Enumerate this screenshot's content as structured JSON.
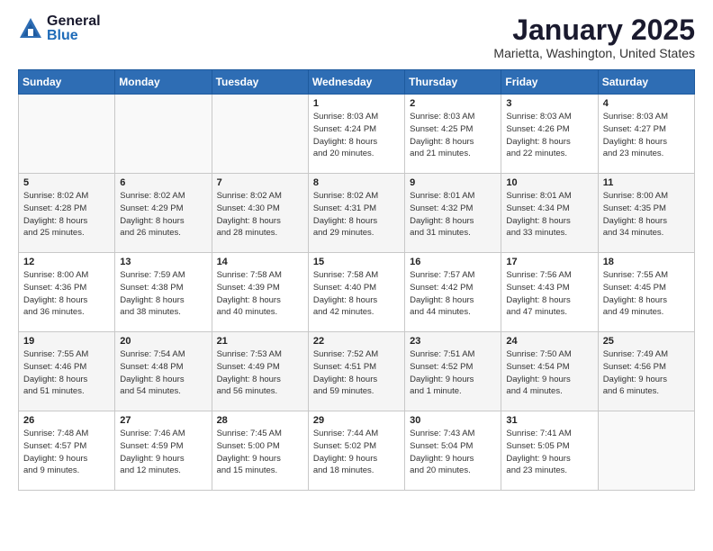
{
  "logo": {
    "general": "General",
    "blue": "Blue"
  },
  "header": {
    "month": "January 2025",
    "location": "Marietta, Washington, United States"
  },
  "weekdays": [
    "Sunday",
    "Monday",
    "Tuesday",
    "Wednesday",
    "Thursday",
    "Friday",
    "Saturday"
  ],
  "weeks": [
    [
      {
        "day": "",
        "info": ""
      },
      {
        "day": "",
        "info": ""
      },
      {
        "day": "",
        "info": ""
      },
      {
        "day": "1",
        "info": "Sunrise: 8:03 AM\nSunset: 4:24 PM\nDaylight: 8 hours\nand 20 minutes."
      },
      {
        "day": "2",
        "info": "Sunrise: 8:03 AM\nSunset: 4:25 PM\nDaylight: 8 hours\nand 21 minutes."
      },
      {
        "day": "3",
        "info": "Sunrise: 8:03 AM\nSunset: 4:26 PM\nDaylight: 8 hours\nand 22 minutes."
      },
      {
        "day": "4",
        "info": "Sunrise: 8:03 AM\nSunset: 4:27 PM\nDaylight: 8 hours\nand 23 minutes."
      }
    ],
    [
      {
        "day": "5",
        "info": "Sunrise: 8:02 AM\nSunset: 4:28 PM\nDaylight: 8 hours\nand 25 minutes."
      },
      {
        "day": "6",
        "info": "Sunrise: 8:02 AM\nSunset: 4:29 PM\nDaylight: 8 hours\nand 26 minutes."
      },
      {
        "day": "7",
        "info": "Sunrise: 8:02 AM\nSunset: 4:30 PM\nDaylight: 8 hours\nand 28 minutes."
      },
      {
        "day": "8",
        "info": "Sunrise: 8:02 AM\nSunset: 4:31 PM\nDaylight: 8 hours\nand 29 minutes."
      },
      {
        "day": "9",
        "info": "Sunrise: 8:01 AM\nSunset: 4:32 PM\nDaylight: 8 hours\nand 31 minutes."
      },
      {
        "day": "10",
        "info": "Sunrise: 8:01 AM\nSunset: 4:34 PM\nDaylight: 8 hours\nand 33 minutes."
      },
      {
        "day": "11",
        "info": "Sunrise: 8:00 AM\nSunset: 4:35 PM\nDaylight: 8 hours\nand 34 minutes."
      }
    ],
    [
      {
        "day": "12",
        "info": "Sunrise: 8:00 AM\nSunset: 4:36 PM\nDaylight: 8 hours\nand 36 minutes."
      },
      {
        "day": "13",
        "info": "Sunrise: 7:59 AM\nSunset: 4:38 PM\nDaylight: 8 hours\nand 38 minutes."
      },
      {
        "day": "14",
        "info": "Sunrise: 7:58 AM\nSunset: 4:39 PM\nDaylight: 8 hours\nand 40 minutes."
      },
      {
        "day": "15",
        "info": "Sunrise: 7:58 AM\nSunset: 4:40 PM\nDaylight: 8 hours\nand 42 minutes."
      },
      {
        "day": "16",
        "info": "Sunrise: 7:57 AM\nSunset: 4:42 PM\nDaylight: 8 hours\nand 44 minutes."
      },
      {
        "day": "17",
        "info": "Sunrise: 7:56 AM\nSunset: 4:43 PM\nDaylight: 8 hours\nand 47 minutes."
      },
      {
        "day": "18",
        "info": "Sunrise: 7:55 AM\nSunset: 4:45 PM\nDaylight: 8 hours\nand 49 minutes."
      }
    ],
    [
      {
        "day": "19",
        "info": "Sunrise: 7:55 AM\nSunset: 4:46 PM\nDaylight: 8 hours\nand 51 minutes."
      },
      {
        "day": "20",
        "info": "Sunrise: 7:54 AM\nSunset: 4:48 PM\nDaylight: 8 hours\nand 54 minutes."
      },
      {
        "day": "21",
        "info": "Sunrise: 7:53 AM\nSunset: 4:49 PM\nDaylight: 8 hours\nand 56 minutes."
      },
      {
        "day": "22",
        "info": "Sunrise: 7:52 AM\nSunset: 4:51 PM\nDaylight: 8 hours\nand 59 minutes."
      },
      {
        "day": "23",
        "info": "Sunrise: 7:51 AM\nSunset: 4:52 PM\nDaylight: 9 hours\nand 1 minute."
      },
      {
        "day": "24",
        "info": "Sunrise: 7:50 AM\nSunset: 4:54 PM\nDaylight: 9 hours\nand 4 minutes."
      },
      {
        "day": "25",
        "info": "Sunrise: 7:49 AM\nSunset: 4:56 PM\nDaylight: 9 hours\nand 6 minutes."
      }
    ],
    [
      {
        "day": "26",
        "info": "Sunrise: 7:48 AM\nSunset: 4:57 PM\nDaylight: 9 hours\nand 9 minutes."
      },
      {
        "day": "27",
        "info": "Sunrise: 7:46 AM\nSunset: 4:59 PM\nDaylight: 9 hours\nand 12 minutes."
      },
      {
        "day": "28",
        "info": "Sunrise: 7:45 AM\nSunset: 5:00 PM\nDaylight: 9 hours\nand 15 minutes."
      },
      {
        "day": "29",
        "info": "Sunrise: 7:44 AM\nSunset: 5:02 PM\nDaylight: 9 hours\nand 18 minutes."
      },
      {
        "day": "30",
        "info": "Sunrise: 7:43 AM\nSunset: 5:04 PM\nDaylight: 9 hours\nand 20 minutes."
      },
      {
        "day": "31",
        "info": "Sunrise: 7:41 AM\nSunset: 5:05 PM\nDaylight: 9 hours\nand 23 minutes."
      },
      {
        "day": "",
        "info": ""
      }
    ]
  ]
}
